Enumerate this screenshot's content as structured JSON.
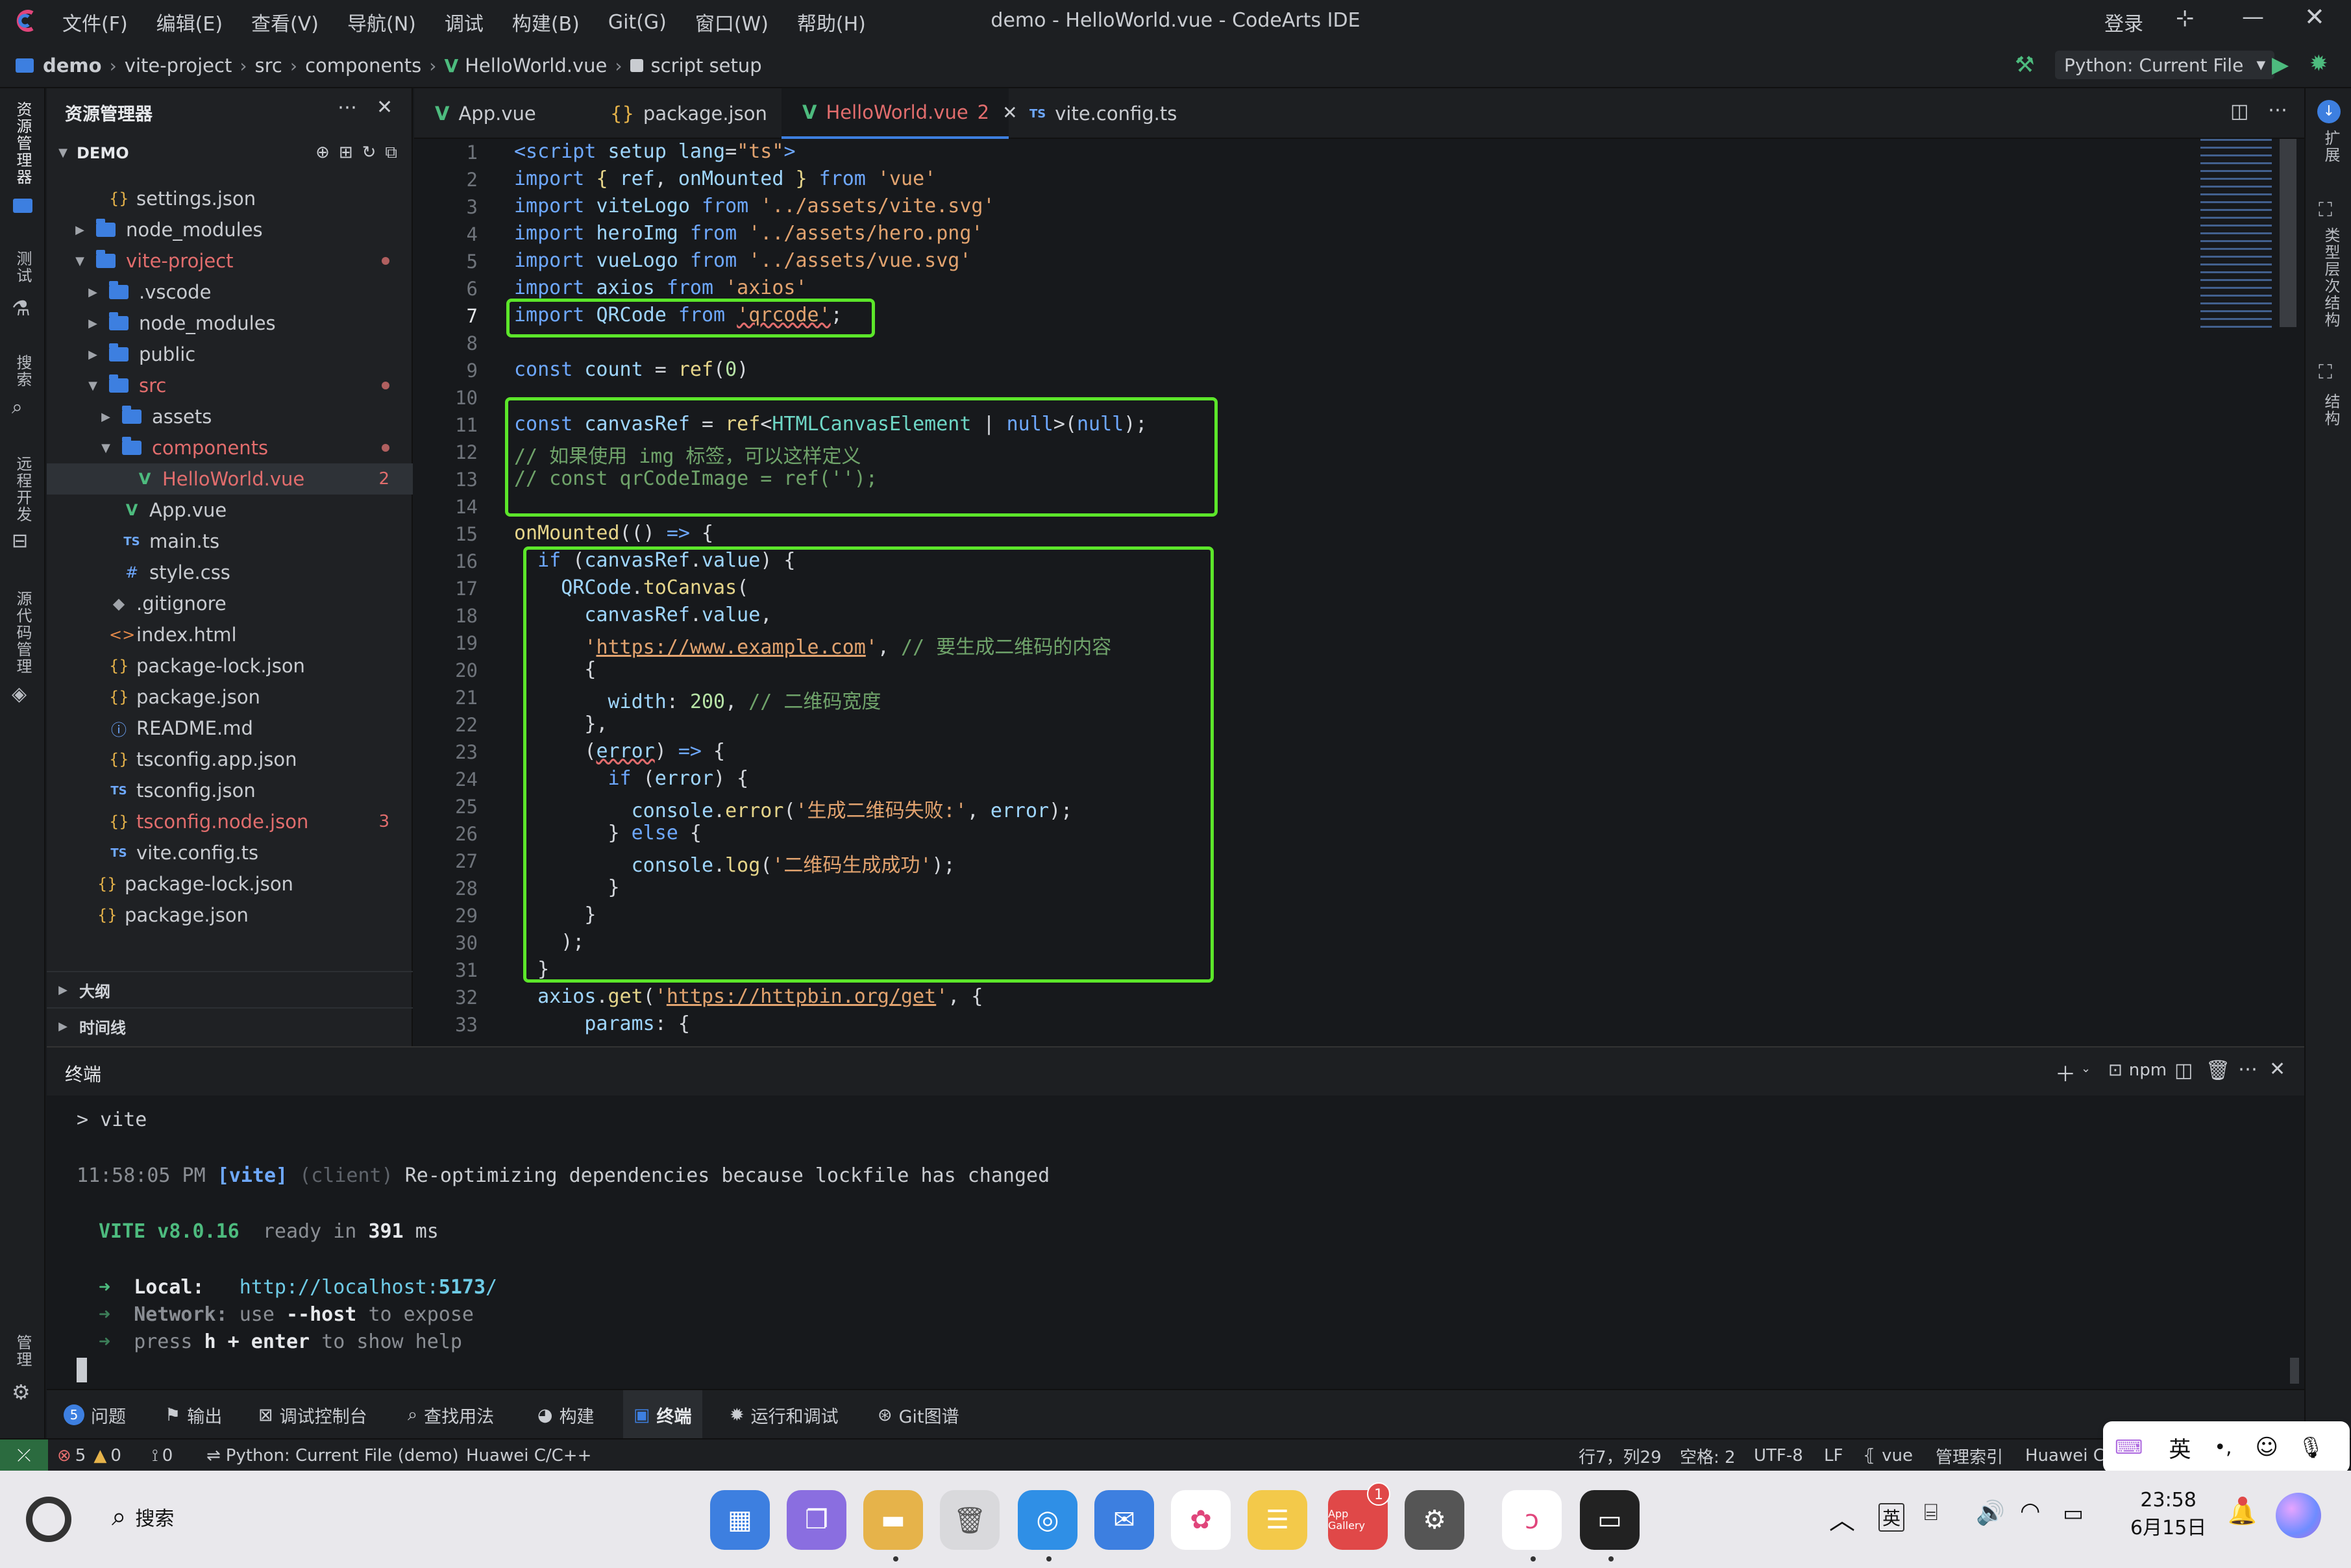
{
  "window": {
    "title": "demo - HelloWorld.vue - CodeArts IDE",
    "login": "登录"
  },
  "menu": [
    "文件(F)",
    "编辑(E)",
    "查看(V)",
    "导航(N)",
    "调试",
    "构建(B)",
    "Git(G)",
    "窗口(W)",
    "帮助(H)"
  ],
  "breadcrumb": [
    "demo",
    "vite-project",
    "src",
    "components",
    "HelloWorld.vue",
    "script setup"
  ],
  "run_config": "Python: Current File",
  "activity_left": [
    "资源管理器",
    "测试",
    "搜索",
    "远程开发",
    "源代码管理",
    "管理"
  ],
  "activity_right": [
    "扩展",
    "类型层次结构",
    "结构"
  ],
  "explorer": {
    "title": "资源管理器",
    "root": "DEMO",
    "items": [
      {
        "label": "settings.json",
        "icon": "{}",
        "color": "#e6b34a"
      },
      {
        "label": "node_modules",
        "icon": "folder"
      },
      {
        "label": "vite-project",
        "icon": "folder",
        "color": "#e26d6d"
      },
      {
        "label": ".vscode",
        "icon": "folder"
      },
      {
        "label": "node_modules",
        "icon": "folder"
      },
      {
        "label": "public",
        "icon": "folder"
      },
      {
        "label": "src",
        "icon": "folder",
        "color": "#e26d6d"
      },
      {
        "label": "assets",
        "icon": "folder"
      },
      {
        "label": "components",
        "icon": "folder",
        "color": "#e26d6d"
      },
      {
        "label": "HelloWorld.vue",
        "icon": "V",
        "color": "#e26d6d",
        "badge": "2"
      },
      {
        "label": "App.vue",
        "icon": "V"
      },
      {
        "label": "main.ts",
        "icon": "TS"
      },
      {
        "label": "style.css",
        "icon": "#"
      },
      {
        "label": ".gitignore",
        "icon": "◆"
      },
      {
        "label": "index.html",
        "icon": "<>"
      },
      {
        "label": "package-lock.json",
        "icon": "{}"
      },
      {
        "label": "package.json",
        "icon": "{}"
      },
      {
        "label": "README.md",
        "icon": "ⓘ"
      },
      {
        "label": "tsconfig.app.json",
        "icon": "{}"
      },
      {
        "label": "tsconfig.json",
        "icon": "TS"
      },
      {
        "label": "tsconfig.node.json",
        "icon": "{}",
        "color": "#e26d6d",
        "badge": "3"
      },
      {
        "label": "vite.config.ts",
        "icon": "TS"
      },
      {
        "label": "package-lock.json",
        "icon": "{}"
      },
      {
        "label": "package.json",
        "icon": "{}"
      }
    ],
    "outline": "大纲",
    "timeline": "时间线"
  },
  "tabs": [
    {
      "label": "App.vue",
      "icon": "V"
    },
    {
      "label": "package.json",
      "icon": "{}"
    },
    {
      "label": "HelloWorld.vue",
      "icon": "V",
      "badge": "2"
    },
    {
      "label": "vite.config.ts",
      "icon": "TS"
    }
  ],
  "line_numbers": [
    "1",
    "2",
    "3",
    "4",
    "5",
    "6",
    "7",
    "8",
    "9",
    "10",
    "11",
    "12",
    "13",
    "14",
    "15",
    "16",
    "17",
    "18",
    "19",
    "20",
    "21",
    "22",
    "23",
    "24",
    "25",
    "26",
    "27",
    "28",
    "29",
    "30",
    "31",
    "32",
    "33"
  ],
  "terminal": {
    "title": "终端",
    "shell": "npm",
    "lines": {
      "cmd": "> vite",
      "time": "11:58:05 PM",
      "tag": "[vite]",
      "client": "(client)",
      "msg": "Re-optimizing dependencies because lockfile has changed",
      "vite": "VITE v8.0.16",
      "ready": "ready in",
      "ms": "391",
      "ms_unit": "ms",
      "local_label": "Local:",
      "local_url_a": "http://localhost:",
      "local_port": "5173",
      "local_url_b": "/",
      "network_label": "Network:",
      "network_use": "use",
      "network_host": "--host",
      "network_rest": "to expose",
      "press": "press",
      "h_enter": "h + enter",
      "help": "to show help"
    }
  },
  "panel_tabs": [
    "问题",
    "输出",
    "调试控制台",
    "查找用法",
    "构建",
    "终端",
    "运行和调试",
    "Git图谱"
  ],
  "problems_count": "5",
  "status": {
    "errors": "5",
    "warnings": "0",
    "ports": "0",
    "python": "Python: Current File (demo)",
    "cpp": "Huawei C/C++",
    "position": "行7，列29",
    "spaces": "空格: 2",
    "encoding": "UTF-8",
    "eol": "LF",
    "lang": "vue",
    "index": "管理索引",
    "huawei": "Huawei C"
  },
  "ime": {
    "lang": "英"
  },
  "taskbar": {
    "search": "搜索",
    "app_gallery_badge": "1",
    "app_gallery_label": "App Gallery",
    "ime": "英",
    "time": "23:58",
    "date": "6月15日"
  }
}
